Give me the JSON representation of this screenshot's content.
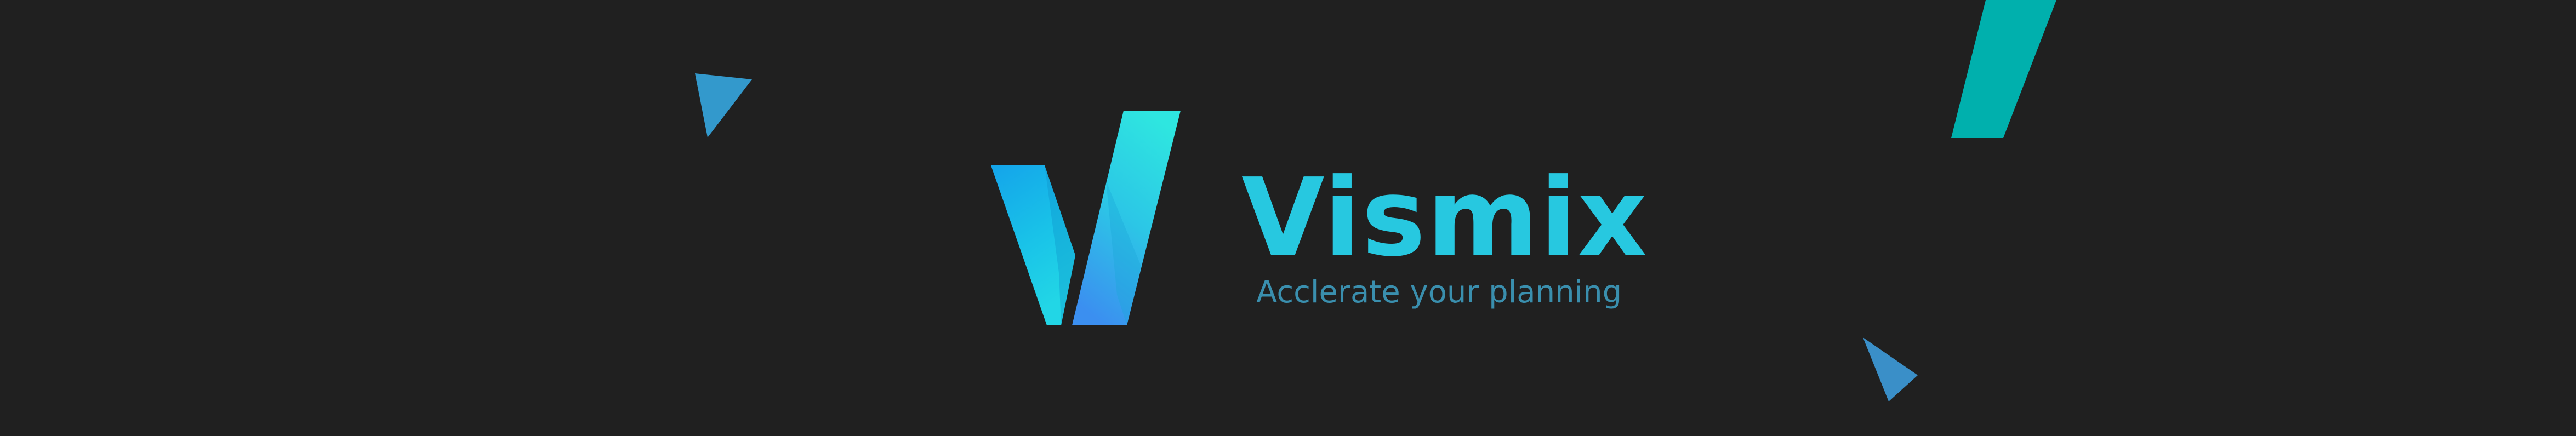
{
  "brand": {
    "name": "Vismix",
    "tagline": "Acclerate your planning"
  },
  "icons": {
    "logo": "vismix-v-logo-icon",
    "decor_top_left": "triangle-icon",
    "decor_top_right": "slanted-bar-icon",
    "decor_bottom_right": "triangle-icon"
  },
  "colors": {
    "background": "#202020",
    "brand_text": "#27c8e0",
    "tagline_text": "#3a8fae",
    "logo_light": "#2ee6e0",
    "logo_blue": "#14a4ea",
    "logo_deep": "#3b8ff0",
    "accent_teal": "#00b0ad",
    "accent_blue": "#3a8fc8"
  }
}
